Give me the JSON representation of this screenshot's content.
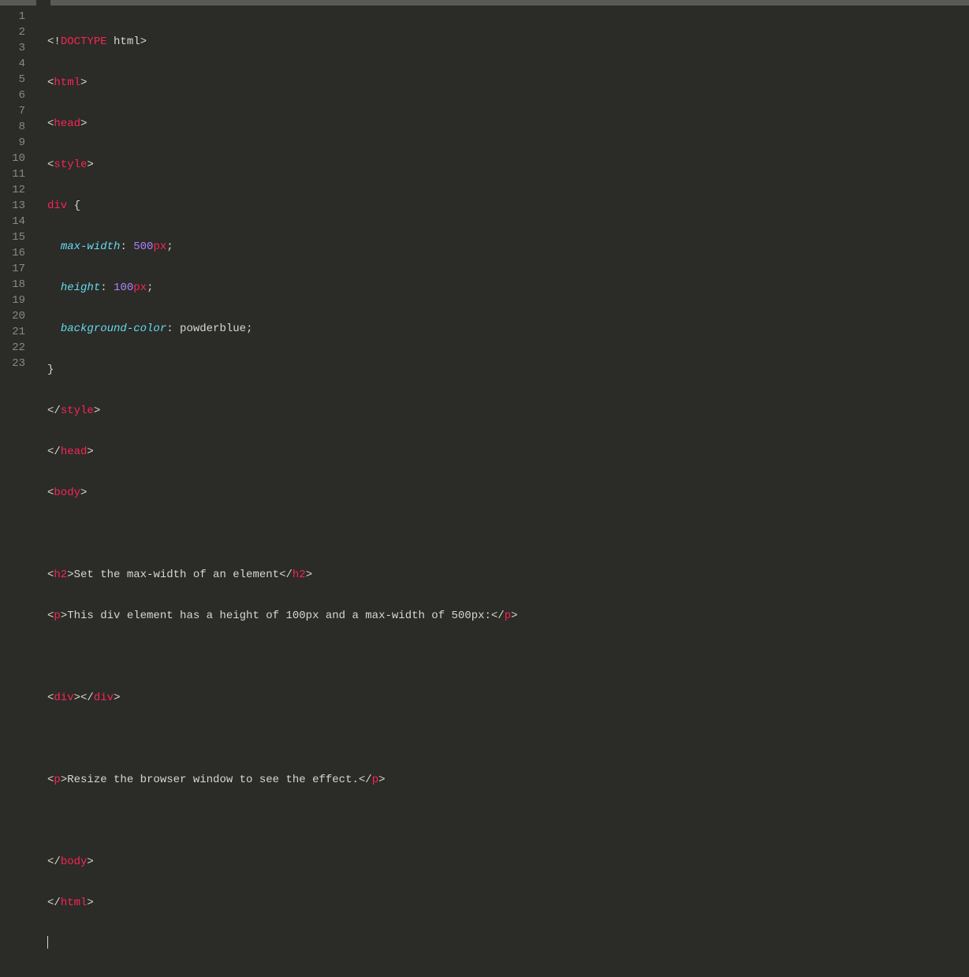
{
  "lineNumbers": [
    "1",
    "2",
    "3",
    "4",
    "5",
    "6",
    "7",
    "8",
    "9",
    "10",
    "11",
    "12",
    "13",
    "14",
    "15",
    "16",
    "17",
    "18",
    "19",
    "20",
    "21",
    "22",
    "23"
  ],
  "code": {
    "l1": {
      "a": "<!",
      "b": "DOCTYPE",
      "c": " html",
      "d": ">"
    },
    "l2": {
      "a": "<",
      "b": "html",
      "c": ">"
    },
    "l3": {
      "a": "<",
      "b": "head",
      "c": ">"
    },
    "l4": {
      "a": "<",
      "b": "style",
      "c": ">"
    },
    "l5": {
      "a": "div",
      "b": " {"
    },
    "l6": {
      "indent": "  ",
      "a": "max-width",
      "b": ": ",
      "c": "500",
      "d": "px",
      "e": ";"
    },
    "l7": {
      "indent": "  ",
      "a": "height",
      "b": ": ",
      "c": "100",
      "d": "px",
      "e": ";"
    },
    "l8": {
      "indent": "  ",
      "a": "background-color",
      "b": ": ",
      "c": "powderblue",
      "d": ";"
    },
    "l9": {
      "a": "}"
    },
    "l10": {
      "a": "</",
      "b": "style",
      "c": ">"
    },
    "l11": {
      "a": "</",
      "b": "head",
      "c": ">"
    },
    "l12": {
      "a": "<",
      "b": "body",
      "c": ">"
    },
    "l14": {
      "a": "<",
      "b": "h2",
      "c": ">",
      "d": "Set the max-width of an element",
      "e": "</",
      "f": "h2",
      "g": ">"
    },
    "l15": {
      "a": "<",
      "b": "p",
      "c": ">",
      "d": "This div element has a height of 100px and a max-width of 500px:",
      "e": "</",
      "f": "p",
      "g": ">"
    },
    "l17": {
      "a": "<",
      "b": "div",
      "c": ">",
      "d": "</",
      "e": "div",
      "f": ">"
    },
    "l19": {
      "a": "<",
      "b": "p",
      "c": ">",
      "d": "Resize the browser window to see the effect.",
      "e": "</",
      "f": "p",
      "g": ">"
    },
    "l21": {
      "a": "</",
      "b": "body",
      "c": ">"
    },
    "l22": {
      "a": "</",
      "b": "html",
      "c": ">"
    }
  }
}
